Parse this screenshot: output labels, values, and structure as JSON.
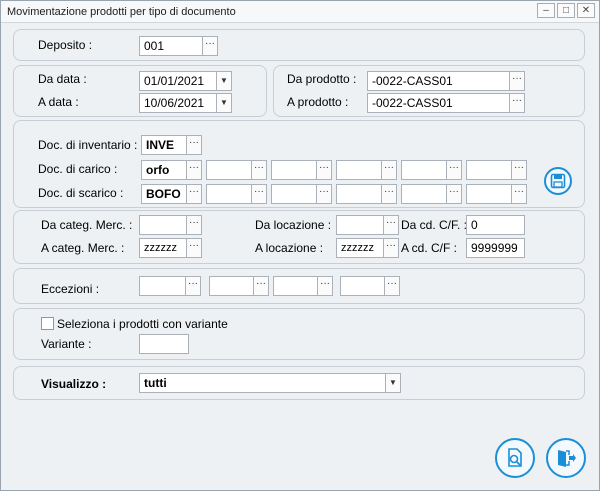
{
  "window": {
    "title": "Movimentazione prodotti per tipo di documento",
    "minimize": "–",
    "maximize": "□",
    "close": "✕"
  },
  "ellipsis": "···",
  "dropdown": "▼",
  "deposito": {
    "label": "Deposito  :",
    "value": "001"
  },
  "dates": {
    "from_label": "Da data :",
    "from_value": "01/01/2021",
    "to_label": "A data :",
    "to_value": "10/06/2021"
  },
  "products": {
    "from_label": "Da prodotto :",
    "from_value": "-0022-CASS01",
    "to_label": "A prodotto :",
    "to_value": "-0022-CASS01"
  },
  "documents": {
    "inventory_label": "Doc. di inventario :",
    "inventory_value": "INVE",
    "load_label": "Doc. di carico :",
    "load_value": "orfo",
    "unload_label": "Doc. di scarico :",
    "unload_value": "BOFO",
    "save_icon": "save-icon"
  },
  "filters": {
    "cat_from_label": "Da categ. Merc. :",
    "cat_from_value": "",
    "cat_to_label": "A categ. Merc. :",
    "cat_to_value": "zzzzzz",
    "loc_from_label": "Da locazione :",
    "loc_from_value": "",
    "loc_to_label": "A locazione :",
    "loc_to_value": "zzzzzz",
    "cf_from_label": "Da cd. C/F. :",
    "cf_from_value": "0",
    "cf_to_label": "A cd. C/F :",
    "cf_to_value": "9999999"
  },
  "exceptions": {
    "label": "Eccezioni :"
  },
  "variant": {
    "checkbox_label": "Seleziona i prodotti con variante",
    "checked": false,
    "label": "Variante :",
    "value": ""
  },
  "display": {
    "label": "Visualizzo :",
    "value": "tutti"
  },
  "actions": {
    "preview_icon": "print-preview-icon",
    "exit_icon": "exit-icon"
  },
  "colors": {
    "accent": "#1b8fd6",
    "background": "#eef1f4",
    "border": "#c7ced6"
  }
}
